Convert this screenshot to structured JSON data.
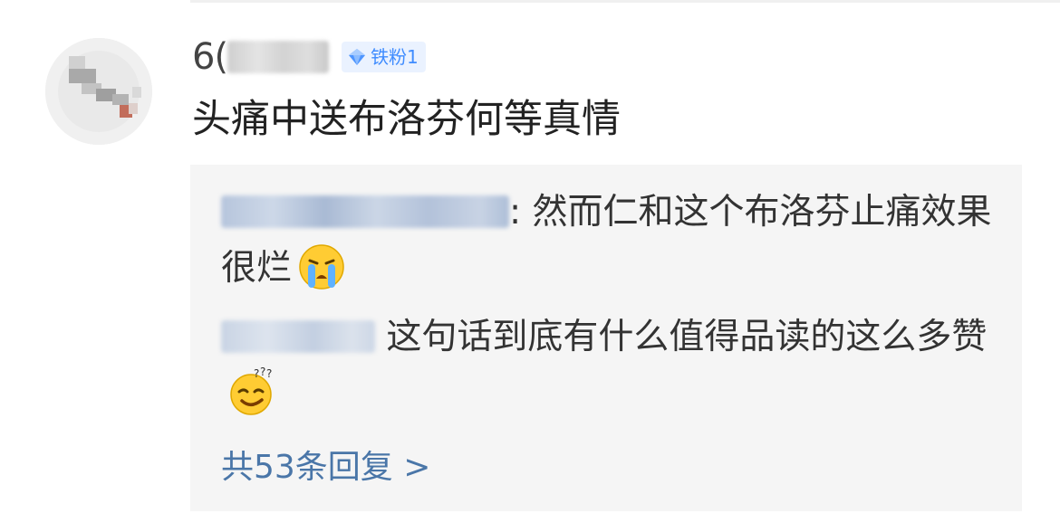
{
  "comment": {
    "username_visible": "6(",
    "badge": {
      "icon": "diamond-icon",
      "label": "铁粉1",
      "color": "#3f8cff"
    },
    "text": "头痛中送布洛芬何等真情"
  },
  "replies": [
    {
      "separator": ":",
      "text": " 然而仁和这个布洛芬止痛效果很烂",
      "emoji": "crying-face-icon"
    },
    {
      "separator": "",
      "text": " 这句话到底有什么值得品读的这么多赞",
      "emoji": "dizzy-face-icon"
    }
  ],
  "more_replies": {
    "label": "共53条回复 >",
    "color": "#4a76a8"
  },
  "colors": {
    "reply_box_bg": "#f5f5f5",
    "link": "#4a76a8"
  }
}
